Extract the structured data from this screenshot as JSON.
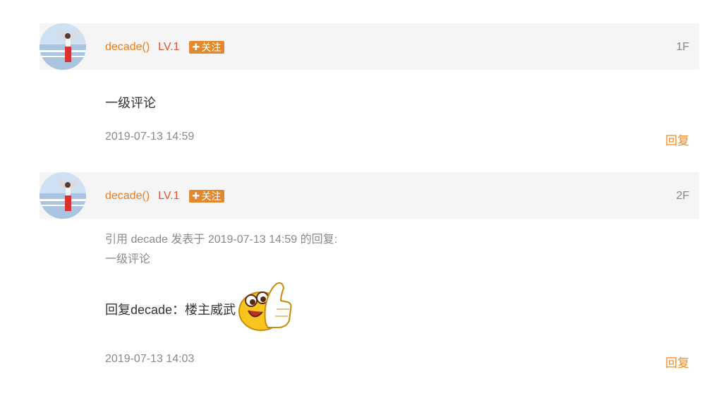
{
  "comments": [
    {
      "username": "decade()",
      "level": "LV.1",
      "follow_label": "关注",
      "floor": "1F",
      "text": "一级评论",
      "timestamp": "2019-07-13 14:59",
      "reply_label": "回复"
    },
    {
      "username": "decade()",
      "level": "LV.1",
      "follow_label": "关注",
      "floor": "2F",
      "quote_header": "引用 decade 发表于 2019-07-13 14:59 的回复:",
      "quote_text": "一级评论",
      "text": "回复decade：楼主威武",
      "emoji": "thumbs-up-emoji",
      "timestamp": "2019-07-13 14:03",
      "reply_label": "回复"
    }
  ],
  "colors": {
    "username": "#f07c1c",
    "level": "#e8512f",
    "follow_bg": "#e1892c",
    "reply": "#f08a1e",
    "header_bg": "#f5f5f5"
  }
}
